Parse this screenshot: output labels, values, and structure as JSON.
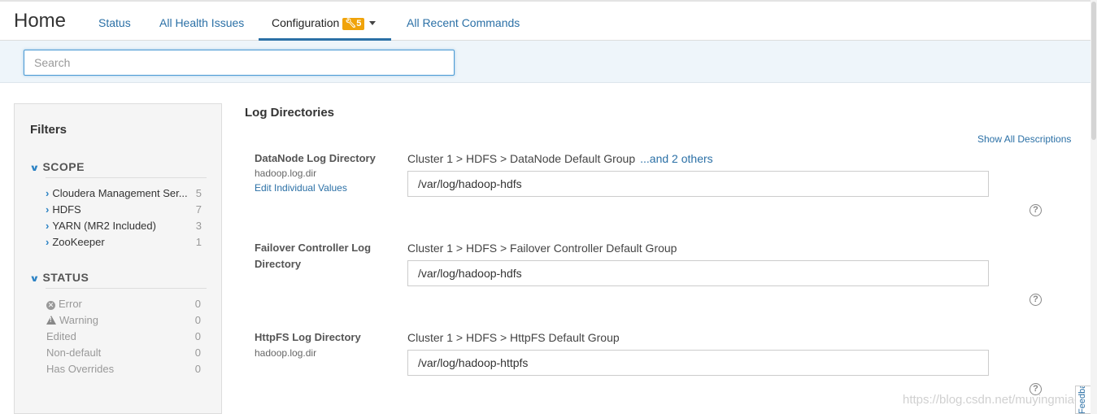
{
  "header": {
    "title": "Home",
    "tabs": [
      {
        "label": "Status"
      },
      {
        "label": "All Health Issues"
      },
      {
        "label": "Configuration",
        "badge": "5",
        "badge_icon": "wrench-icon"
      },
      {
        "label": "All Recent Commands"
      }
    ],
    "accent_color": "#2b70a6",
    "badge_color": "#f0a30a"
  },
  "search": {
    "placeholder": "Search",
    "value": ""
  },
  "filters": {
    "title": "Filters",
    "scope": {
      "heading": "SCOPE",
      "items": [
        {
          "label": "Cloudera Management Ser...",
          "count": "5"
        },
        {
          "label": "HDFS",
          "count": "7"
        },
        {
          "label": "YARN (MR2 Included)",
          "count": "3"
        },
        {
          "label": "ZooKeeper",
          "count": "1"
        }
      ]
    },
    "status": {
      "heading": "STATUS",
      "items": [
        {
          "label": "Error",
          "count": "0",
          "icon": "error-icon"
        },
        {
          "label": "Warning",
          "count": "0",
          "icon": "warning-icon"
        },
        {
          "label": "Edited",
          "count": "0"
        },
        {
          "label": "Non-default",
          "count": "0"
        },
        {
          "label": "Has Overrides",
          "count": "0"
        }
      ]
    }
  },
  "main": {
    "title": "Log Directories",
    "show_all_descriptions": "Show All Descriptions",
    "properties": [
      {
        "label": "DataNode Log Directory",
        "sub": "hadoop.log.dir",
        "link": "Edit Individual Values",
        "scope_path": "Cluster 1 > HDFS > DataNode Default Group",
        "others": "...and 2 others",
        "value": "/var/log/hadoop-hdfs"
      },
      {
        "label_line1": "Failover Controller Log",
        "label_line2": "Directory",
        "scope_path": "Cluster 1 > HDFS > Failover Controller Default Group",
        "value": "/var/log/hadoop-hdfs"
      },
      {
        "label": "HttpFS Log Directory",
        "sub": "hadoop.log.dir",
        "scope_path": "Cluster 1 > HDFS > HttpFS Default Group",
        "value": "/var/log/hadoop-httpfs"
      }
    ]
  },
  "watermark": "https://blog.csdn.net/muyingmiao",
  "feedback_label": "Feedback"
}
